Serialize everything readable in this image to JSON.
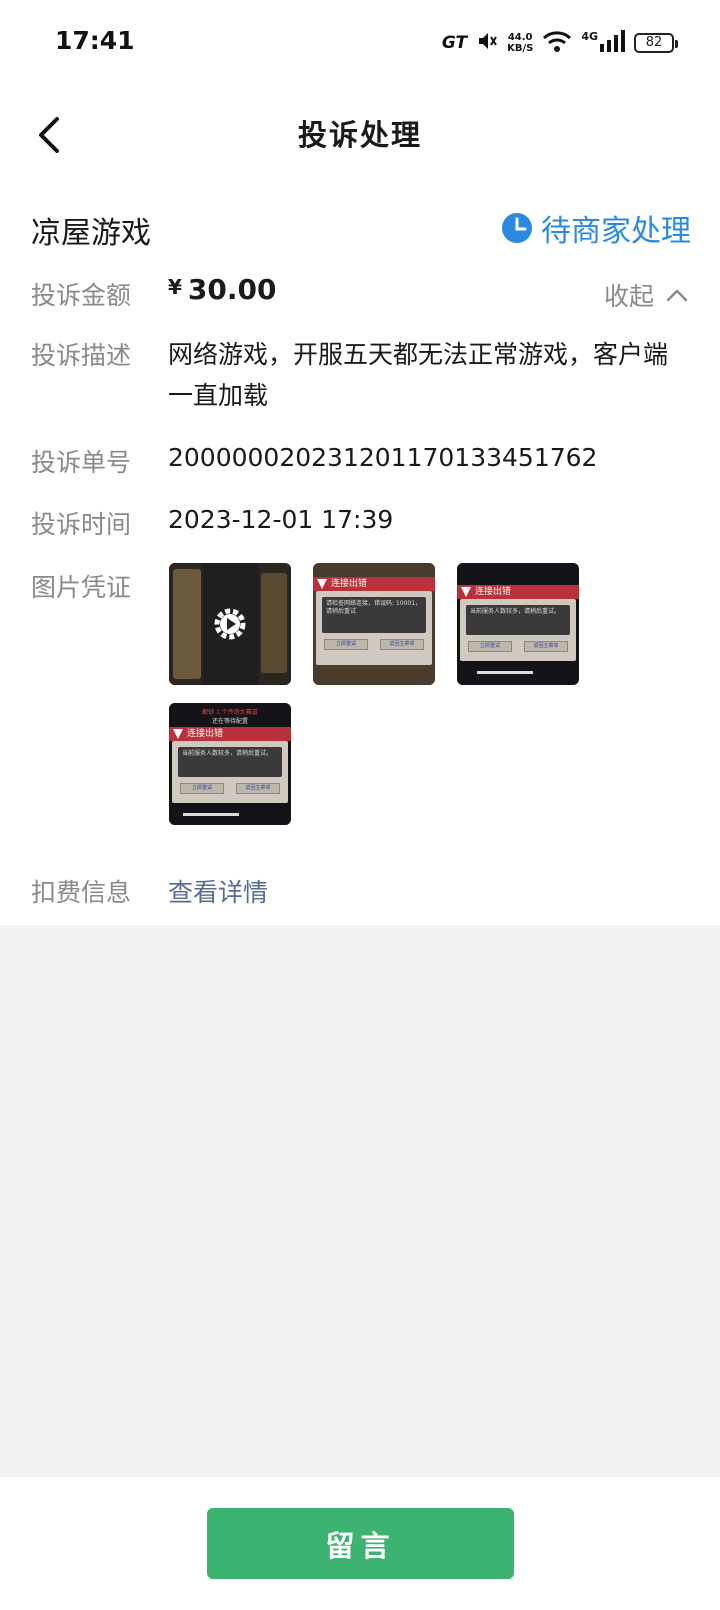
{
  "status_bar": {
    "time": "17:41",
    "gt": "GT",
    "speed_value": "44.0",
    "speed_unit": "KB/S",
    "network": "4G",
    "battery": "82"
  },
  "nav": {
    "title": "投诉处理",
    "back_icon": "chevron-left-icon"
  },
  "merchant": {
    "name": "凉屋游戏",
    "status": "待商家处理",
    "status_icon": "clock-icon",
    "status_color": "#2b8ae0"
  },
  "details": {
    "amount_label": "投诉金额",
    "currency": "¥",
    "amount": "30.00",
    "collapse_label": "收起",
    "desc_label": "投诉描述",
    "desc": "网络游戏，开服五天都无法正常游戏，客户端一直加载",
    "order_label": "投诉单号",
    "order_no": "200000020231201170133451762",
    "time_label": "投诉时间",
    "time": "2023-12-01 17:39",
    "evidence_label": "图片凭证",
    "fee_label": "扣费信息",
    "fee_link": "查看详情"
  },
  "evidence": {
    "video_icon": "play-gear-icon",
    "dialog_title": "连接出错",
    "thumb2_text": "请检查网络连接，错误码: 10001，请稍后重试",
    "thumb3_text": "当前服务人数较多，请稍后重试。",
    "thumb4_top": "解锁 1 个传奇大赛道",
    "thumb4_sub": "还在等待配置",
    "retry_label": "立即重试",
    "home_label": "返回主菜单"
  },
  "colors": {
    "primary_green": "#3cb371",
    "link": "#576b95"
  },
  "bottom": {
    "message_button": "留言"
  }
}
